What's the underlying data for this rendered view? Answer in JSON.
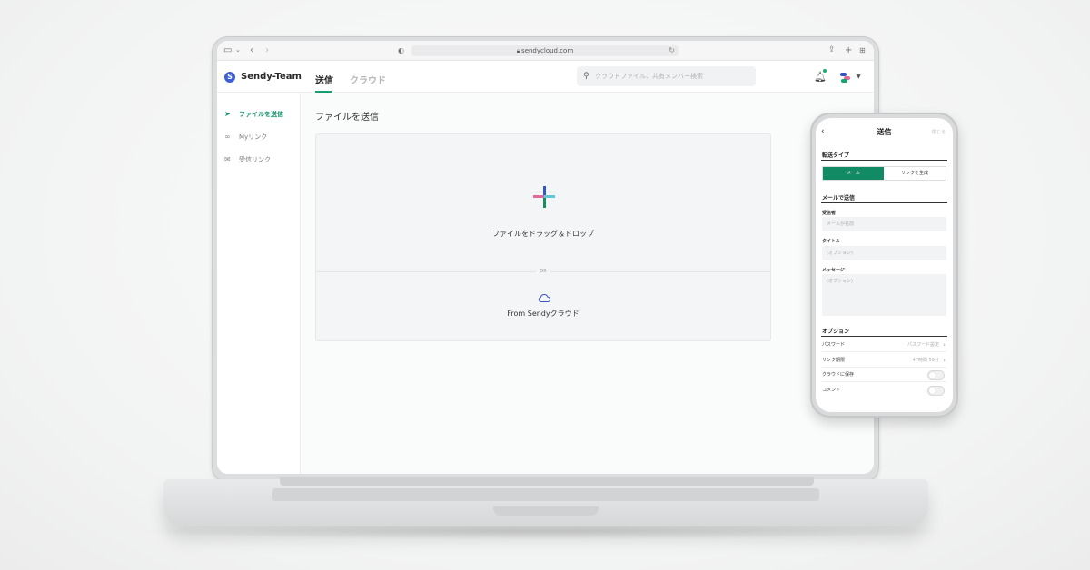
{
  "browser": {
    "url": "sendycloud.com",
    "sidebar_icon": "sidebar-toggle-icon",
    "back_icon": "chevron-left-icon",
    "forward_icon": "chevron-right-icon",
    "share_icon": "share-icon",
    "new_tab_icon": "plus-icon",
    "tabs_icon": "tab-overview-icon"
  },
  "header": {
    "logo_letter": "S",
    "brand": "Sendy-Team",
    "tabs": [
      {
        "label": "送信",
        "active": true
      },
      {
        "label": "クラウド",
        "active": false
      }
    ],
    "search_placeholder": "クラウドファイル、共有メンバー検索",
    "accent": "#15a071"
  },
  "sidebar": {
    "items": [
      {
        "label": "ファイルを送信",
        "icon": "paper-plane-icon",
        "active": true
      },
      {
        "label": "Myリンク",
        "icon": "link-icon",
        "active": false
      },
      {
        "label": "受信リンク",
        "icon": "mail-icon",
        "active": false
      }
    ]
  },
  "main": {
    "title": "ファイルを送信",
    "drop_text": "ファイルをドラッグ＆ドロップ",
    "or_text": "OR",
    "cloud_text": "From Sendyクラウド"
  },
  "phone": {
    "title": "送信",
    "close_label": "閉じる",
    "transfer_type_heading": "転送タイプ",
    "segments": [
      "メール",
      "リンクを生成"
    ],
    "email_heading": "メールで送信",
    "recipient_label": "受信者",
    "recipient_placeholder": "メールか名前",
    "subject_label": "タイトル",
    "subject_placeholder": "(オプション)",
    "message_label": "メッセージ",
    "message_placeholder": "(オプション)",
    "options_heading": "オプション",
    "options": [
      {
        "label": "パスワード",
        "value": "パスワード設定"
      },
      {
        "label": "リンク期限",
        "value": "47時間 59分"
      },
      {
        "label": "クラウドに保存",
        "toggle": false
      },
      {
        "label": "コメント",
        "toggle": false
      }
    ],
    "accent": "#128a63"
  }
}
